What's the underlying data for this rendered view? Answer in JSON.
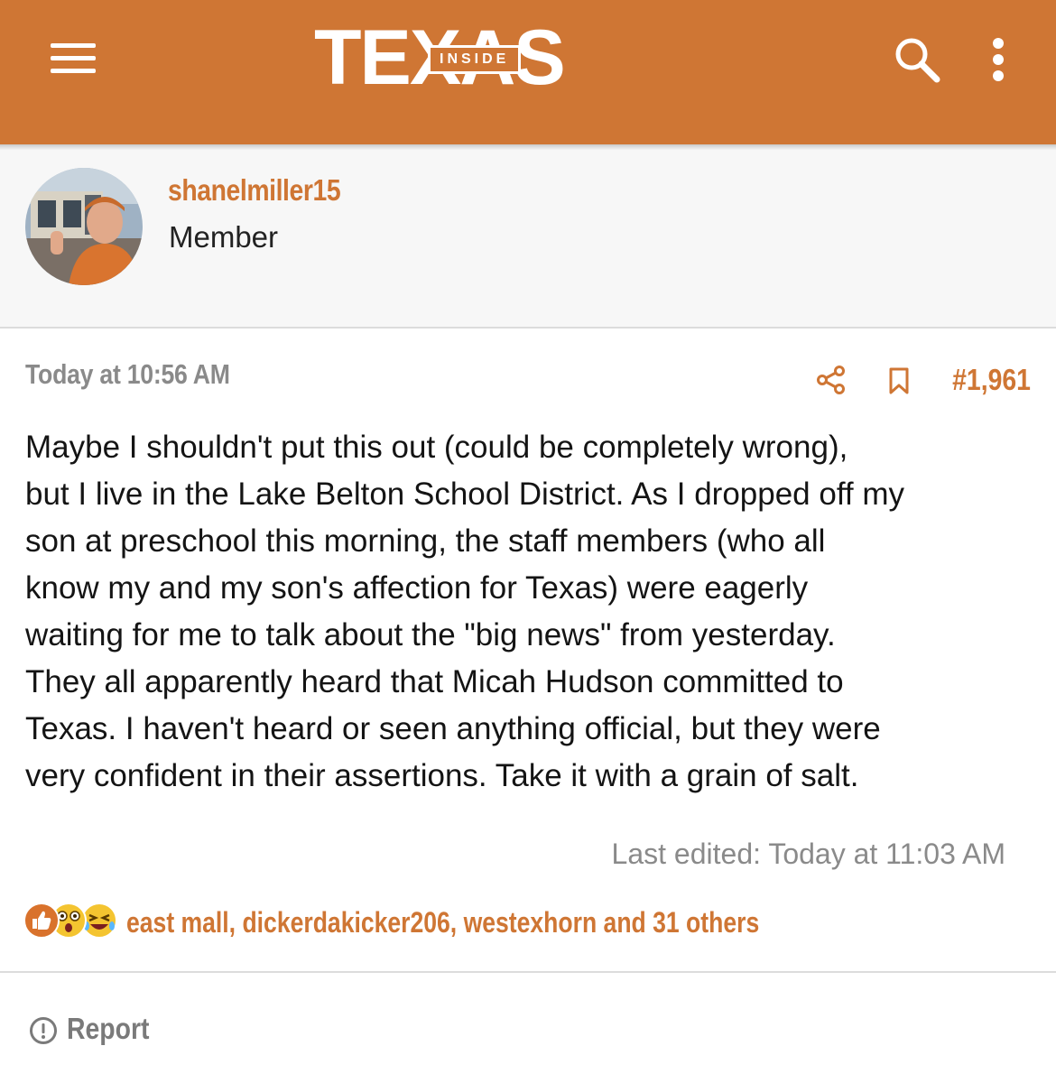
{
  "header": {
    "logo_main": "TEXAS",
    "logo_badge": "INSIDE",
    "menu_icon": "hamburger-menu-icon",
    "search_icon": "search-icon",
    "more_icon": "more-vertical-icon",
    "background_color": "#cf7634"
  },
  "user": {
    "username": "shanelmiller15",
    "title": "Member"
  },
  "post": {
    "date": "Today at 10:56 AM",
    "number": "#1,961",
    "share_icon": "share-icon",
    "bookmark_icon": "bookmark-icon",
    "lines": [
      "Maybe I shouldn't put this out (could be completely wrong),",
      "but I live in the Lake Belton School District. As I dropped off my",
      "son at preschool this morning, the staff members (who all",
      "know my and my son's affection for Texas) were eagerly",
      "waiting for me to talk about the \"big news\" from yesterday.",
      "They all apparently heard that Micah Hudson committed to",
      "Texas. I haven't heard or seen anything official, but they were",
      "very confident in their assertions. Take it with a grain of salt."
    ],
    "last_edited": "Last edited: Today at 11:03 AM"
  },
  "reactions": {
    "icons": [
      "like-icon",
      "wow-icon",
      "laugh-icon"
    ],
    "names": "east mall, dickerdakicker206, westexhorn and 31 others"
  },
  "footer": {
    "report_label": "Report",
    "report_icon": "alert-circle-icon"
  },
  "colors": {
    "accent": "#cf7634",
    "muted": "#8a8a8a",
    "text": "#141414"
  }
}
